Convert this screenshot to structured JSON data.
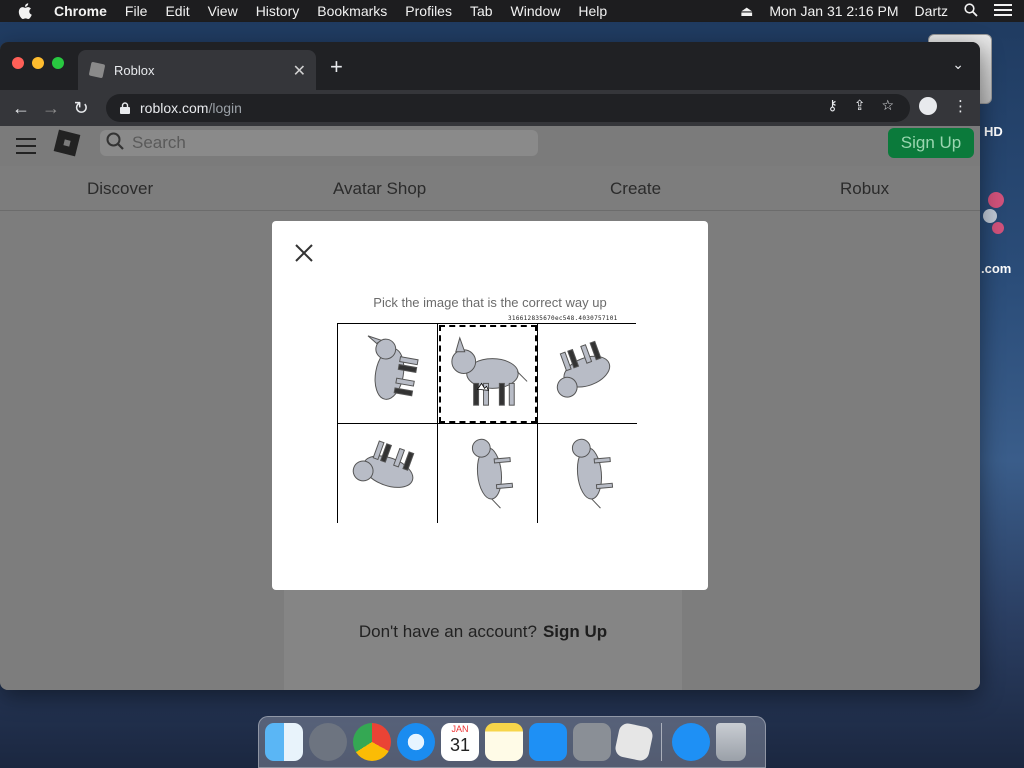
{
  "menubar": {
    "app": "Chrome",
    "items": [
      "File",
      "Edit",
      "View",
      "History",
      "Bookmarks",
      "Profiles",
      "Tab",
      "Window",
      "Help"
    ],
    "datetime": "Mon Jan 31  2:16 PM",
    "user": "Dartz"
  },
  "desktop": {
    "hd_label": "HD",
    "com_label": ".com"
  },
  "browser": {
    "tab_title": "Roblox",
    "url_host": "roblox.com",
    "url_path": "/login"
  },
  "roblox": {
    "search_placeholder": "Search",
    "signup_label": "Sign Up",
    "nav": [
      "Discover",
      "Avatar Shop",
      "Create",
      "Robux"
    ],
    "account_question": "Don't have an account?",
    "account_link": "Sign Up"
  },
  "captcha": {
    "prompt": "Pick the image that is the correct way up",
    "token": "316612835670ec548.4030757101",
    "selected_index": 1,
    "images": [
      "rotated-left",
      "upright",
      "upside-down-right",
      "upside-down",
      "standing-vertical",
      "standing-vertical"
    ]
  },
  "dock": {
    "apps": [
      "finder-icon",
      "launchpad-icon",
      "chrome-icon",
      "safari-icon",
      "calendar-icon",
      "notes-icon",
      "app-store-icon",
      "system-preferences-icon",
      "roblox-icon",
      "app-store-icon-2",
      "trash-icon"
    ],
    "calendar_month": "JAN",
    "calendar_day": "31"
  }
}
